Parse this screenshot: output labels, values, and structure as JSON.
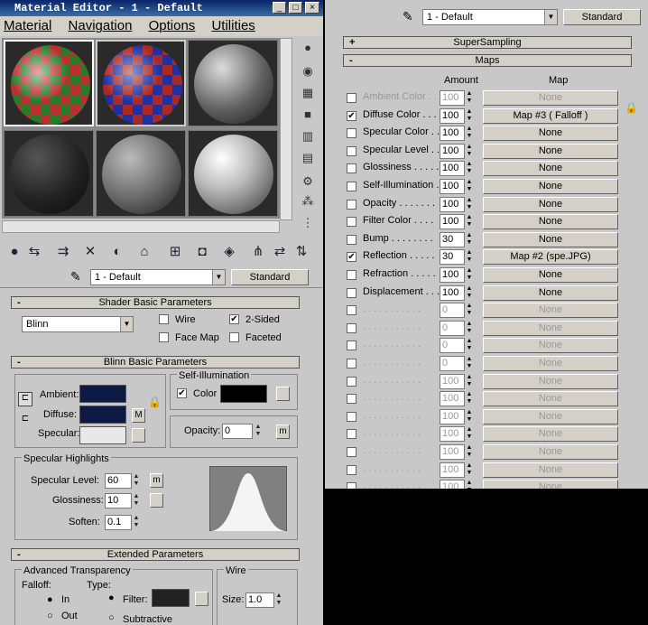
{
  "title": "Material Editor - 1 - Default",
  "menu": [
    "Material",
    "Navigation",
    "Options",
    "Utilities"
  ],
  "material_name": "1 - Default",
  "material_type": "Standard",
  "shader": {
    "header": "Shader Basic Parameters",
    "type": "Blinn",
    "wire": "Wire",
    "two_sided": "2-Sided",
    "face_map": "Face Map",
    "faceted": "Faceted"
  },
  "blinn": {
    "header": "Blinn Basic Parameters",
    "ambient": "Ambient:",
    "diffuse": "Diffuse:",
    "specular": "Specular:",
    "m": "M",
    "self_illum": "Self-Illumination",
    "color": "Color",
    "opacity_label": "Opacity:",
    "opacity": "0",
    "m2": "m"
  },
  "specular": {
    "group": "Specular Highlights",
    "level_label": "Specular Level:",
    "level": "60",
    "gloss_label": "Glossiness:",
    "gloss": "10",
    "soften_label": "Soften:",
    "soften": "0.1",
    "m": "m"
  },
  "extended": {
    "header": "Extended Parameters",
    "adv": "Advanced Transparency",
    "falloff": "Falloff:",
    "type": "Type:",
    "in": "In",
    "out": "Out",
    "filter": "Filter:",
    "subtractive": "Subtractive",
    "wire": "Wire",
    "size_label": "Size:",
    "size": "1.0"
  },
  "colors": {
    "ambient": "#0c1a44",
    "diffuse": "#0c1a44",
    "specular": "#e8e8e8",
    "self_illum": "#000000",
    "filter": "#222222"
  },
  "right": {
    "material_name": "1 - Default",
    "material_type": "Standard",
    "supersampling": "SuperSampling",
    "maps": "Maps",
    "col_amount": "Amount",
    "col_map": "Map",
    "rows": [
      {
        "label": "Ambient Color . . .",
        "amount": "100",
        "map": "None",
        "checked": false,
        "dim": true
      },
      {
        "label": "Diffuse Color . . . .",
        "amount": "100",
        "map": "Map #3  ( Falloff )",
        "checked": true,
        "dim": false
      },
      {
        "label": "Specular Color . . .",
        "amount": "100",
        "map": "None",
        "checked": false,
        "dim": false
      },
      {
        "label": "Specular Level . . .",
        "amount": "100",
        "map": "None",
        "checked": false,
        "dim": false
      },
      {
        "label": "Glossiness . . . . .",
        "amount": "100",
        "map": "None",
        "checked": false,
        "dim": false
      },
      {
        "label": "Self-Illumination . .",
        "amount": "100",
        "map": "None",
        "checked": false,
        "dim": false
      },
      {
        "label": "Opacity . . . . . . .",
        "amount": "100",
        "map": "None",
        "checked": false,
        "dim": false
      },
      {
        "label": "Filter Color . . . .",
        "amount": "100",
        "map": "None",
        "checked": false,
        "dim": false
      },
      {
        "label": "Bump . . . . . . . .",
        "amount": "30",
        "map": "None",
        "checked": false,
        "dim": false
      },
      {
        "label": "Reflection . . . . .",
        "amount": "30",
        "map": "Map #2 (spe.JPG)",
        "checked": true,
        "dim": false
      },
      {
        "label": "Refraction . . . . .",
        "amount": "100",
        "map": "None",
        "checked": false,
        "dim": false
      },
      {
        "label": "Displacement . . .",
        "amount": "100",
        "map": "None",
        "checked": false,
        "dim": false
      },
      {
        "label": ". . . . . . . . . . .",
        "amount": "0",
        "map": "None",
        "checked": false,
        "dim": true
      },
      {
        "label": ". . . . . . . . . . .",
        "amount": "0",
        "map": "None",
        "checked": false,
        "dim": true
      },
      {
        "label": ". . . . . . . . . . .",
        "amount": "0",
        "map": "None",
        "checked": false,
        "dim": true
      },
      {
        "label": ". . . . . . . . . . .",
        "amount": "0",
        "map": "None",
        "checked": false,
        "dim": true
      },
      {
        "label": ". . . . . . . . . . .",
        "amount": "100",
        "map": "None",
        "checked": false,
        "dim": true
      },
      {
        "label": ". . . . . . . . . . .",
        "amount": "100",
        "map": "None",
        "checked": false,
        "dim": true
      },
      {
        "label": ". . . . . . . . . . .",
        "amount": "100",
        "map": "None",
        "checked": false,
        "dim": true
      },
      {
        "label": ". . . . . . . . . . .",
        "amount": "100",
        "map": "None",
        "checked": false,
        "dim": true
      },
      {
        "label": ". . . . . . . . . . .",
        "amount": "100",
        "map": "None",
        "checked": false,
        "dim": true
      },
      {
        "label": ". . . . . . . . . . .",
        "amount": "100",
        "map": "None",
        "checked": false,
        "dim": true
      },
      {
        "label": ". . . . . . . . . . .",
        "amount": "100",
        "map": "None",
        "checked": false,
        "dim": true
      }
    ]
  }
}
